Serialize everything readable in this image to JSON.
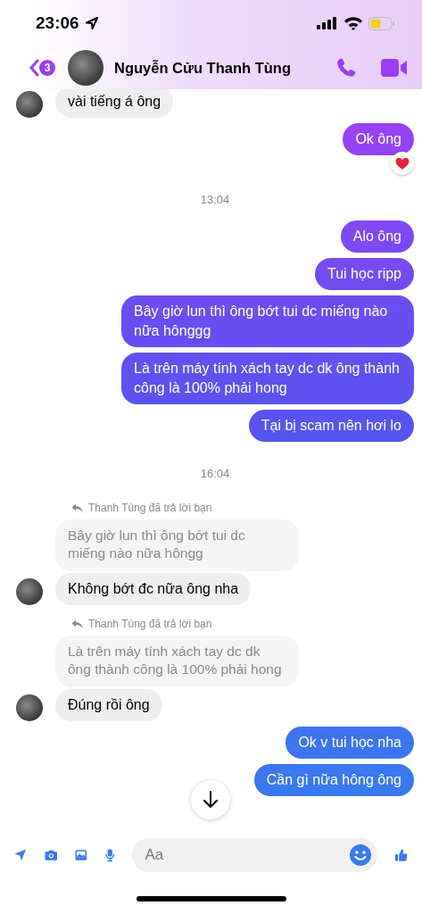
{
  "status_bar": {
    "time": "23:06"
  },
  "header": {
    "back_badge": "3",
    "name": "Nguyễn Cửu Thanh Tùng"
  },
  "messages": [
    {
      "kind": "incoming",
      "text": "vài tiếng á ông"
    },
    {
      "kind": "outgoing",
      "text": "Ok ông",
      "reaction": true
    },
    {
      "kind": "time",
      "text": "13:04"
    },
    {
      "kind": "outgoing",
      "text": "Alo ông",
      "reaction": false
    },
    {
      "kind": "outgoing",
      "text": "Tui học ripp",
      "reaction": false
    },
    {
      "kind": "outgoing",
      "text": "Bây giờ lun thì ông bớt tui dc miếng nào nữa hônggg",
      "reaction": false
    },
    {
      "kind": "outgoing",
      "text": "Là trên máy tính xách tay dc dk ông thành công là 100% phải hong",
      "reaction": false
    },
    {
      "kind": "outgoing",
      "text": "Tại bị scam nên hơi lo",
      "reaction": false
    },
    {
      "kind": "time",
      "text": "16:04"
    },
    {
      "kind": "reply",
      "label": "Thanh Tùng đã trả lời bạn",
      "quote": "Bây giờ lun thì ông bớt tui dc miếng nào nữa hôngg",
      "text": "Không bớt đc nữa ông nha"
    },
    {
      "kind": "reply",
      "label": "Thanh Tùng đã trả lời bạn",
      "quote": "Là trên máy tính xách tay dc dk ông thành công là 100% phải hong",
      "text": "Đúng rồi ông"
    },
    {
      "kind": "outgoing",
      "text": "Ok v tui học nha",
      "reaction": false
    },
    {
      "kind": "outgoing",
      "text": "Cần gì nữa hông ông",
      "reaction": false
    }
  ],
  "composer": {
    "placeholder": "Aa"
  }
}
